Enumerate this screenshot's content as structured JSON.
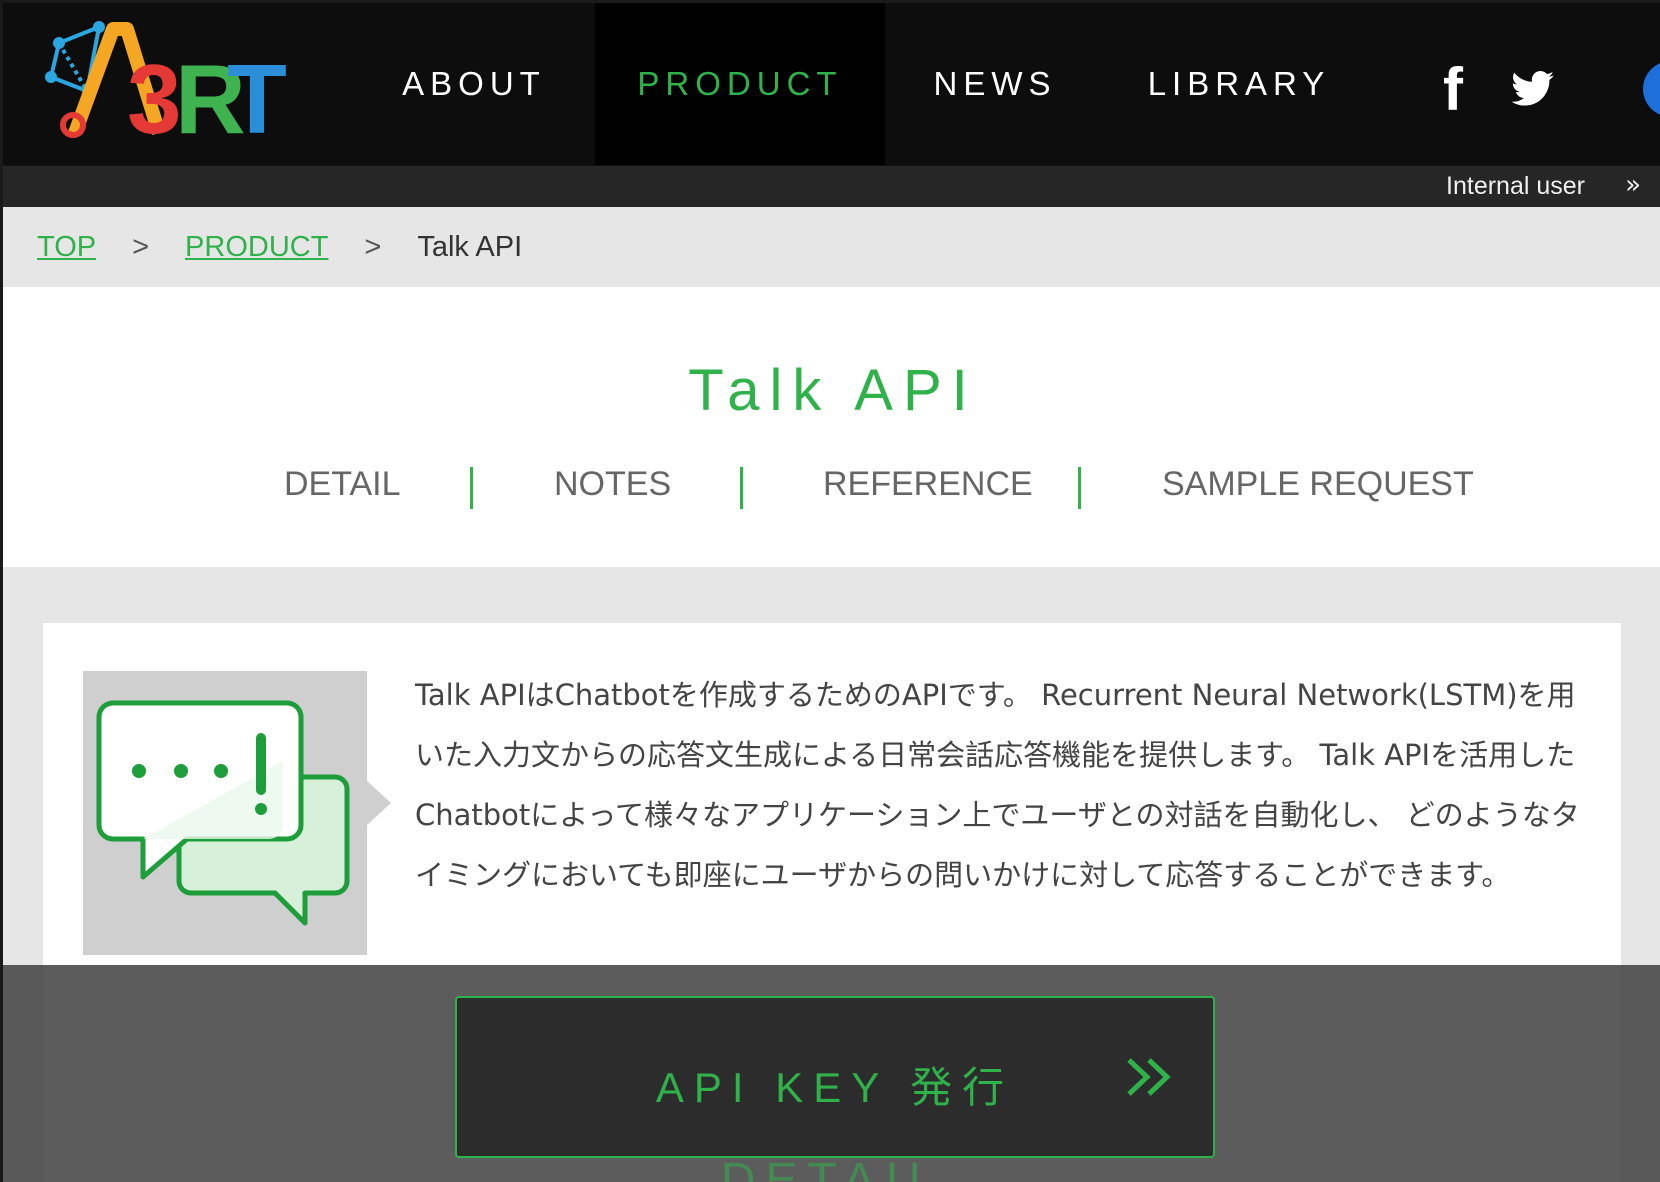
{
  "header": {
    "logo_alt": "A3RT",
    "nav": [
      {
        "label": "ABOUT",
        "active": false
      },
      {
        "label": "PRODUCT",
        "active": true
      },
      {
        "label": "NEWS",
        "active": false
      },
      {
        "label": "LIBRARY",
        "active": false
      }
    ],
    "social": {
      "facebook_glyph": "f"
    },
    "internal_user": "Internal user",
    "internal_user_chevron": "»"
  },
  "breadcrumb": {
    "items": [
      "TOP",
      "PRODUCT",
      "Talk API"
    ],
    "separator": ">"
  },
  "page": {
    "title": "Talk API",
    "tabs": [
      "DETAIL",
      "NOTES",
      "REFERENCE",
      "SAMPLE REQUEST"
    ]
  },
  "content": {
    "description": "Talk APIはChatbotを作成するためのAPIです。 Recurrent Neural Network(LSTM)を用いた入力文からの応答文生成による日常会話応答機能を提供します。 Talk APIを活用したChatbotによって様々なアプリケーション上でユーザとの対話を自動化し、 どのようなタイミングにおいても即座にユーザからの問いかけに対して応答することができます。"
  },
  "cta": {
    "label": "API KEY 発行",
    "next_section_label": "DETAIL"
  },
  "colors": {
    "accent_green": "#2fb24a",
    "header_bg": "#0d0d0d",
    "active_nav_bg": "#000000",
    "page_bg": "#e6e6e6"
  },
  "icons": [
    "a3rt-logo",
    "facebook-icon",
    "twitter-icon",
    "chat-bubbles-icon",
    "double-chevron-right-icon"
  ]
}
